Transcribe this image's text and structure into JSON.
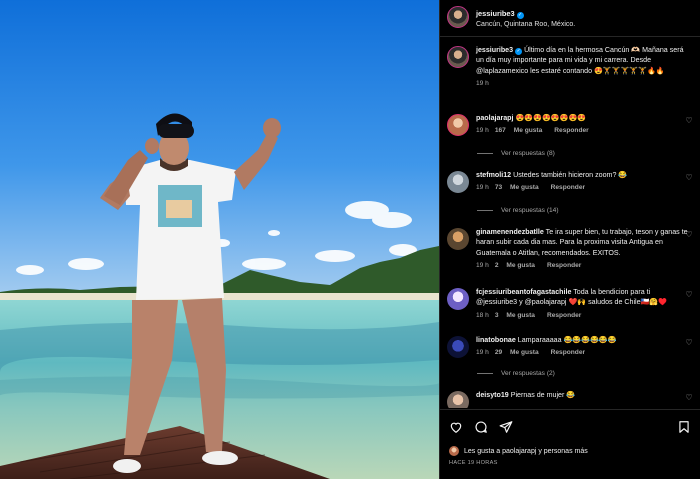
{
  "post": {
    "author": "jessiuribe3",
    "location": "Cancún, Quintana Roo, México.",
    "caption_author": "jessiuribe3",
    "caption": "Último día en la hermosa Cancún 🫶🏻 Mañana será un día muy importante para mi vida y mi carrera. Desde @laplazamexico les estaré contando 😍🏋️🏋️🏋️🏋️🏋️🔥🔥",
    "caption_time": "19 h"
  },
  "labels": {
    "likes": "Me gusta",
    "reply": "Responder"
  },
  "comments": [
    {
      "user": "paolajarapj",
      "text": "😍😍😍😍😍😍😍😍",
      "time": "19 h",
      "likes": "167",
      "replies": "Ver respuestas (8)"
    },
    {
      "user": "stefmoli12",
      "text": "Ustedes también hicieron zoom? 😂",
      "time": "19 h",
      "likes": "73",
      "replies": "Ver respuestas (14)"
    },
    {
      "user": "ginamenendezbatlle",
      "text": "Te ira super bien, tu trabajo, teson y ganas te haran subir cada dia mas. Para la proxima visita Antigua en Guatemala o Atitlan, recomendados. EXITOS.",
      "time": "19 h",
      "likes": "2",
      "replies": ""
    },
    {
      "user": "fcjessiuribeantofagastachile",
      "text": "Toda la bendicion para ti @jessiuribe3 y @paolajarapj ❤️🙌 saludos de Chile🇨🇱🤗♥️",
      "time": "18 h",
      "likes": "3",
      "replies": ""
    },
    {
      "user": "linatobonae",
      "text": "Lamparaaaaa 😂😂😂😂😂😂",
      "time": "19 h",
      "likes": "29",
      "replies": "Ver respuestas (2)"
    },
    {
      "user": "deisyto19",
      "text": "Piernas de mujer 😂",
      "time": "",
      "likes": "",
      "replies": ""
    }
  ],
  "footer": {
    "liked_by": "Les gusta a paolajarapj y personas más",
    "time_ago": "HACE 19 HORAS"
  },
  "icons": {
    "like": "heart-icon",
    "comment": "comment-icon",
    "share": "share-icon",
    "save": "bookmark-icon"
  },
  "colors": {
    "background": "#000000",
    "verified": "#0095f6",
    "secondary_text": "#a8a8a8",
    "sky": "#1f7fe0",
    "sea": "#6fc7c9"
  }
}
